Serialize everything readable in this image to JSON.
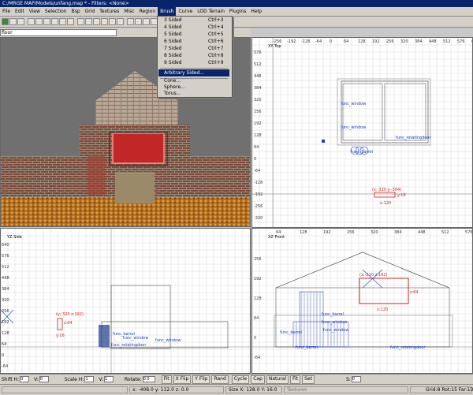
{
  "window": {
    "title": "C:/MRGE MAP/Models/unfang.map * - Filters: <None>"
  },
  "menubar": {
    "items": [
      "File",
      "Edit",
      "View",
      "Selection",
      "Bsp",
      "Grid",
      "Textures",
      "Misc",
      "Region",
      "Brush",
      "Curve",
      "LOD Terrain",
      "Plugins",
      "Help"
    ]
  },
  "texture_field": {
    "value": "floor"
  },
  "brush_menu": {
    "items": [
      {
        "label": "3 Sided",
        "shortcut": "Ctrl+3"
      },
      {
        "label": "4 Sided",
        "shortcut": "Ctrl+4"
      },
      {
        "label": "5 Sided",
        "shortcut": "Ctrl+5"
      },
      {
        "label": "6 Sided",
        "shortcut": "Ctrl+6"
      },
      {
        "label": "7 Sided",
        "shortcut": "Ctrl+7"
      },
      {
        "label": "8 Sided",
        "shortcut": "Ctrl+8"
      },
      {
        "label": "9 Sided",
        "shortcut": "Ctrl+9"
      }
    ],
    "arbitrary": "Arbitrary Sided...",
    "cone": "Cone...",
    "sphere": "Sphere...",
    "torus": "Torus..."
  },
  "views": {
    "xy": {
      "label": "XY Top",
      "entities": [
        "func_window",
        "func_window",
        "func_rotatingdoor",
        "func_barrel"
      ],
      "coord_label": "(x:-320 y:-304)",
      "dim_w": "x:120",
      "dim_h": "y:16",
      "x_ticks": [
        "-256",
        "-192",
        "-128",
        "-64",
        "0",
        "64",
        "128",
        "192",
        "256",
        "320",
        "384",
        "448",
        "512",
        "576",
        "640"
      ],
      "y_ticks": [
        "576",
        "512",
        "448",
        "384",
        "320",
        "256",
        "192",
        "128",
        "64",
        "0",
        "-64",
        "-128",
        "-192",
        "-256",
        "-320"
      ]
    },
    "yz": {
      "label": "YZ Side",
      "entities": [
        "func_barrel",
        "func_window",
        "func_window",
        "func_rotatingdoor"
      ],
      "coord_label": "(y:-320 z:192)",
      "dim_h": "z:64",
      "dim_w": "y:16",
      "y_ticks": [
        "640",
        "576",
        "512",
        "448",
        "384",
        "320",
        "256",
        "192",
        "128",
        "64",
        "0",
        "-64",
        "-128"
      ]
    },
    "xz": {
      "label": "XZ Front",
      "entities": [
        "func_barrel",
        "func_window",
        "func_barrel",
        "func_window",
        "func_barrel",
        "func_rotatingdoor"
      ],
      "coord_label": "(x:-320 z:192)",
      "dim_w": "x:120",
      "dim_h": "z:64",
      "x_ticks": [
        "64",
        "128",
        "192",
        "256",
        "320",
        "384",
        "448",
        "512",
        "576"
      ],
      "y_ticks": [
        "256",
        "192",
        "128",
        "64",
        "0",
        "-64"
      ]
    }
  },
  "bottombar": {
    "shift_h_label": "Shift H:",
    "shift_h": "0",
    "shift_v_label": "V:",
    "shift_v": "0",
    "scale_h_label": "Scale H:",
    "scale_h": "1",
    "scale_v_label": "V:",
    "scale_v": "1",
    "rotate_label": "Rotate:",
    "rotate": "0.0",
    "buttons": [
      "Fit",
      "X Flip",
      "Y Flip",
      "Rand",
      "Cycle",
      "Cap",
      "Natural",
      "Fit",
      "Set"
    ],
    "s_label": "S:",
    "s_value": "0"
  },
  "statusbar": {
    "coords": "x: -408.0  y: 112.0  z: 0.0",
    "size": "Size X: 128.0  Y: 16.0",
    "textures": "Textures",
    "grid": "Grid:8 Rot:15 Far:13"
  },
  "colors": {
    "titlebar": "#0a246a",
    "selection": "#cc2020",
    "entity": "#2040c0"
  }
}
